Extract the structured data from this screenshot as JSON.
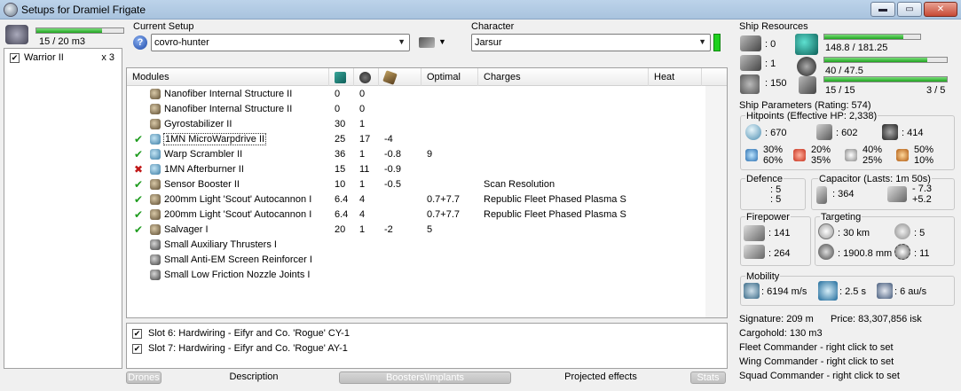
{
  "window": {
    "title": "Setups for Dramiel Frigate",
    "min_glyph": "▬",
    "max_glyph": "▭",
    "close_glyph": "✕"
  },
  "drones": {
    "bandwidth": "15 / 20 m3",
    "bandwidth_fraction": 0.75,
    "items": [
      {
        "name": "Warrior II",
        "qty": "x 3",
        "checked": true
      }
    ]
  },
  "setup": {
    "label": "Current Setup",
    "help_glyph": "?",
    "value": "covro-hunter",
    "arrow": "▼"
  },
  "character": {
    "label": "Character",
    "value": "Jarsur",
    "arrow": "▼"
  },
  "modules": {
    "headers": {
      "modules": "Modules",
      "optimal": "Optimal",
      "charges": "Charges",
      "heat": "Heat"
    },
    "rows": [
      {
        "status": "",
        "icon": "structure-icon",
        "name": "Nanofiber Internal Structure II",
        "cpu": "0",
        "pg": "0",
        "cap": "",
        "optimal": "",
        "charges": ""
      },
      {
        "status": "",
        "icon": "structure-icon",
        "name": "Nanofiber Internal Structure II",
        "cpu": "0",
        "pg": "0",
        "cap": "",
        "optimal": "",
        "charges": ""
      },
      {
        "status": "",
        "icon": "gyro-icon",
        "name": "Gyrostabilizer II",
        "cpu": "30",
        "pg": "1",
        "cap": "",
        "optimal": "",
        "charges": ""
      },
      {
        "status": "✔",
        "icon": "mwd-icon",
        "name": "1MN MicroWarpdrive II",
        "cpu": "25",
        "pg": "17",
        "cap": "-4",
        "optimal": "",
        "charges": "",
        "selected": true
      },
      {
        "status": "✔",
        "icon": "scrambler-icon",
        "name": "Warp Scrambler II",
        "cpu": "36",
        "pg": "1",
        "cap": "-0.8",
        "optimal": "9",
        "charges": ""
      },
      {
        "status": "✖",
        "icon": "afterburner-icon",
        "name": "1MN Afterburner II",
        "cpu": "15",
        "pg": "11",
        "cap": "-0.9",
        "optimal": "",
        "charges": ""
      },
      {
        "status": "✔",
        "icon": "sensor-booster-icon",
        "name": "Sensor Booster II",
        "cpu": "10",
        "pg": "1",
        "cap": "-0.5",
        "optimal": "",
        "charges": "Scan Resolution"
      },
      {
        "status": "✔",
        "icon": "autocannon-icon",
        "name": "200mm Light 'Scout' Autocannon I",
        "cpu": "6.4",
        "pg": "4",
        "cap": "",
        "optimal": "0.7+7.7",
        "charges": "Republic Fleet Phased Plasma S"
      },
      {
        "status": "✔",
        "icon": "autocannon-icon",
        "name": "200mm Light 'Scout' Autocannon I",
        "cpu": "6.4",
        "pg": "4",
        "cap": "",
        "optimal": "0.7+7.7",
        "charges": "Republic Fleet Phased Plasma S"
      },
      {
        "status": "✔",
        "icon": "salvager-icon",
        "name": "Salvager I",
        "cpu": "20",
        "pg": "1",
        "cap": "-2",
        "optimal": "5",
        "charges": ""
      },
      {
        "status": "",
        "icon": "rig-icon",
        "name": "Small Auxiliary Thrusters I",
        "cpu": "",
        "pg": "",
        "cap": "",
        "optimal": "",
        "charges": ""
      },
      {
        "status": "",
        "icon": "rig-icon",
        "name": "Small Anti-EM Screen Reinforcer I",
        "cpu": "",
        "pg": "",
        "cap": "",
        "optimal": "",
        "charges": ""
      },
      {
        "status": "",
        "icon": "rig-icon",
        "name": "Small Low Friction Nozzle Joints I",
        "cpu": "",
        "pg": "",
        "cap": "",
        "optimal": "",
        "charges": ""
      }
    ]
  },
  "implants": [
    {
      "checked": true,
      "text": "Slot 6: Hardwiring - Eifyr and Co. 'Rogue' CY-1"
    },
    {
      "checked": true,
      "text": "Slot 7: Hardwiring - Eifyr and Co. 'Rogue' AY-1"
    }
  ],
  "tabs": {
    "drones": "Drones",
    "description": "Description",
    "boosters": "Boosters\\Implants",
    "projected": "Projected effects",
    "stats": "Stats"
  },
  "resources": {
    "title": "Ship Resources",
    "turrets": ": 0",
    "launchers": ": 1",
    "calibration": ": 150",
    "cpu": "148.8 / 181.25",
    "cpu_fraction": 0.82,
    "powergrid": "40 / 47.5",
    "powergrid_fraction": 0.84,
    "slots": "15 / 15",
    "slots_fraction": 1.0,
    "rigs": "3 / 5"
  },
  "params": {
    "title": "Ship Parameters (Rating: 574)",
    "hitpoints_title": "Hitpoints (Effective HP: 2,338)",
    "shield_hp": ": 670",
    "armor_hp": ": 602",
    "structure_hp": ": 414",
    "resists": [
      {
        "a": "30%",
        "b": "60%"
      },
      {
        "a": "20%",
        "b": "35%"
      },
      {
        "a": "40%",
        "b": "25%"
      },
      {
        "a": "50%",
        "b": "10%"
      }
    ],
    "defence_title": "Defence",
    "defence_a": ": 5",
    "defence_b": ": 5",
    "capacitor_title": "Capacitor (Lasts: 1m 50s)",
    "capacitor_amount": ": 364",
    "capacitor_delta_a": "- 7.3",
    "capacitor_delta_b": "+5.2",
    "firepower_title": "Firepower",
    "firepower_a": ": 141",
    "firepower_b": ": 264",
    "targeting_title": "Targeting",
    "target_range": ": 30 km",
    "max_targets": ": 5",
    "scan_res": ": 1900.8 mm",
    "sensor_str": ": 11",
    "mobility_title": "Mobility",
    "speed": ": 6194 m/s",
    "align": ": 2.5 s",
    "warp": ": 6 au/s"
  },
  "info": {
    "signature": "Signature: 209 m",
    "price": "Price: 83,307,856 isk",
    "cargohold": "Cargohold: 130 m3",
    "fleet": "Fleet Commander - right click to set",
    "wing": "Wing Commander - right click to set",
    "squad": "Squad Commander - right click to set"
  }
}
